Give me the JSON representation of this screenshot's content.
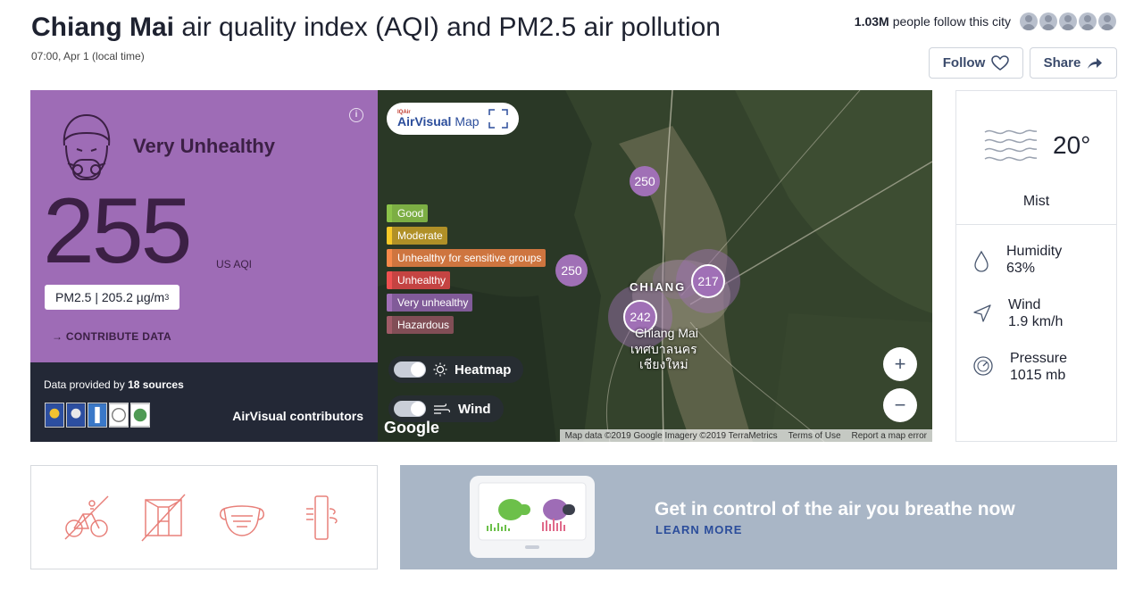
{
  "header": {
    "city": "Chiang Mai",
    "title_rest": " air quality index (AQI) and PM2.5 air pollution",
    "timestamp": "07:00, Apr 1 (local time)",
    "followers_count": "1.03M",
    "followers_text": "people follow this city",
    "follow_label": "Follow",
    "share_label": "Share"
  },
  "aqi": {
    "status": "Very Unhealthy",
    "value": "255",
    "unit": "US AQI",
    "pollutant_label": "PM2.5 | 205.2 µg/m",
    "pollutant_exp": "3",
    "contribute_label": "→ CONTRIBUTE DATA",
    "color": "#9e6cb6"
  },
  "sources": {
    "prefix": "Data provided by ",
    "count": "18 sources",
    "contributors": "AirVisual contributors"
  },
  "map": {
    "brand_small": "IQAir",
    "brand_name": "AirVisual",
    "brand_suffix": "Map",
    "legend": [
      {
        "label": "Good"
      },
      {
        "label": "Moderate"
      },
      {
        "label": "Unhealthy for sensitive groups"
      },
      {
        "label": "Unhealthy"
      },
      {
        "label": "Very unhealthy"
      },
      {
        "label": "Hazardous"
      }
    ],
    "heatmap_label": "Heatmap",
    "wind_label": "Wind",
    "markers": {
      "m1": "250",
      "m2": "250",
      "m3": "217",
      "m4": "242"
    },
    "city_label_en_1": "CHIANG",
    "city_label_en_2": "Chiang Mai",
    "city_label_th_1": "เทศบาลนคร",
    "city_label_th_2": "เชียงใหม่",
    "google": "Google",
    "attribution": "Map data ©2019 Google Imagery ©2019 TerraMetrics",
    "terms": "Terms of Use",
    "report": "Report a map error",
    "zoom_in": "+",
    "zoom_out": "−"
  },
  "weather": {
    "temperature": "20°",
    "condition": "Mist",
    "humidity_label": "Humidity",
    "humidity_value": "63%",
    "wind_label": "Wind",
    "wind_value": "1.9 km/h",
    "pressure_label": "Pressure",
    "pressure_value": "1015 mb"
  },
  "promo": {
    "title": "Get in control of the air you breathe now",
    "link": "LEARN MORE"
  }
}
